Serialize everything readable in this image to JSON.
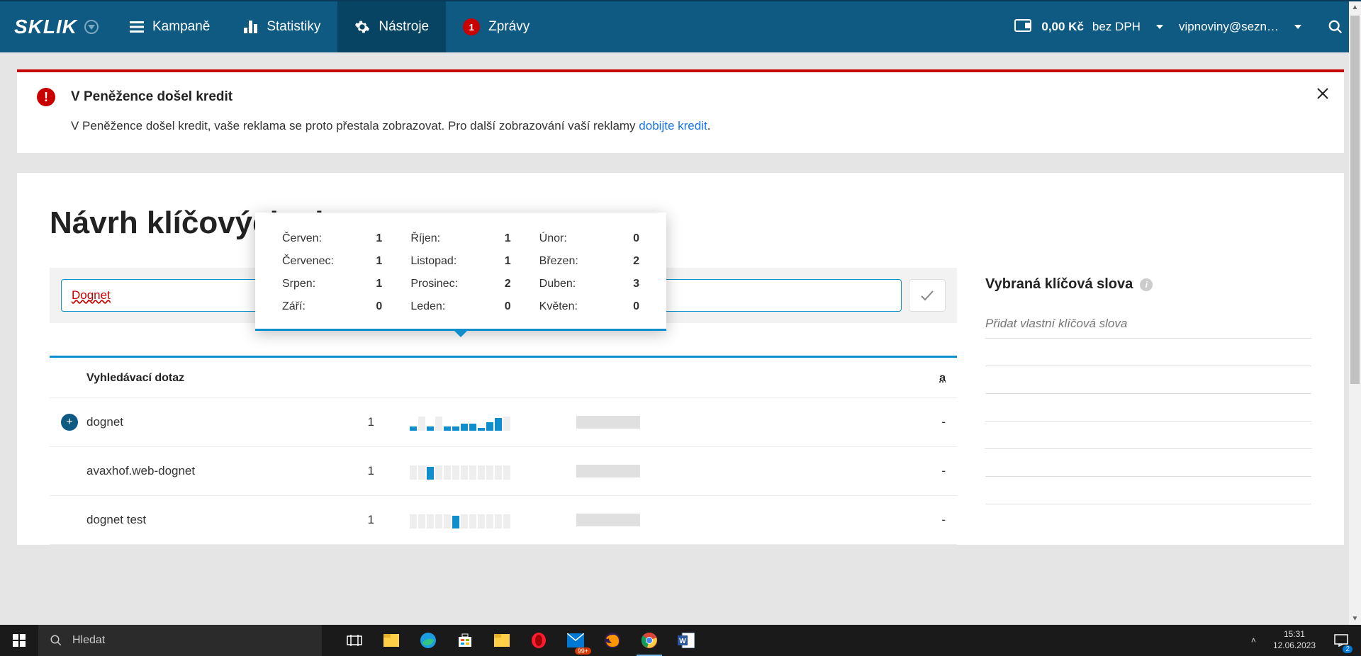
{
  "header": {
    "logo": "SKLIK",
    "nav": {
      "campaigns": "Kampaně",
      "stats": "Statistiky",
      "tools": "Nástroje",
      "messages": "Zprávy",
      "messages_badge": "1"
    },
    "balance": "0,00 Kč",
    "vat": "bez DPH",
    "user": "vipnoviny@sezn…"
  },
  "alert": {
    "title": "V Peněžence došel kredit",
    "body_prefix": "V Peněžence došel kredit, vaše reklama se proto přestala zobrazovat. Pro další zobrazování vaší reklamy ",
    "link": "dobijte kredit",
    "body_suffix": "."
  },
  "page": {
    "title": "Návrh klíčových slov",
    "search_value": "Dognet",
    "table": {
      "col_kw": "Vyhledávací dotaz",
      "col_comp_suffix": "a"
    },
    "rows": [
      {
        "kw": "dognet",
        "searches": "1",
        "trend": [
          6,
          0,
          6,
          0,
          6,
          6,
          10,
          10,
          4,
          12,
          18,
          0
        ],
        "comp": "-",
        "add": true
      },
      {
        "kw": "avaxhof.web-dognet",
        "searches": "1",
        "trend": [
          0,
          0,
          18,
          0,
          0,
          0,
          0,
          0,
          0,
          0,
          0,
          0
        ],
        "comp": "-",
        "add": false
      },
      {
        "kw": "dognet test",
        "searches": "1",
        "trend": [
          0,
          0,
          0,
          0,
          0,
          18,
          0,
          0,
          0,
          0,
          0,
          0
        ],
        "comp": "-",
        "add": false
      }
    ]
  },
  "tooltip": {
    "col1": [
      {
        "label": "Červen:",
        "val": "1"
      },
      {
        "label": "Červenec:",
        "val": "1"
      },
      {
        "label": "Srpen:",
        "val": "1"
      },
      {
        "label": "Září:",
        "val": "0"
      }
    ],
    "col2": [
      {
        "label": "Říjen:",
        "val": "1"
      },
      {
        "label": "Listopad:",
        "val": "1"
      },
      {
        "label": "Prosinec:",
        "val": "2"
      },
      {
        "label": "Leden:",
        "val": "0"
      }
    ],
    "col3": [
      {
        "label": "Únor:",
        "val": "0"
      },
      {
        "label": "Březen:",
        "val": "2"
      },
      {
        "label": "Duben:",
        "val": "3"
      },
      {
        "label": "Květen:",
        "val": "0"
      }
    ]
  },
  "selected": {
    "title": "Vybraná klíčová slova",
    "placeholder": "Přidat vlastní klíčová slova"
  },
  "taskbar": {
    "search": "Hledat",
    "time": "15:31",
    "date": "12.06.2023",
    "notif": "2",
    "badge99": "99+"
  },
  "chart_data": {
    "type": "bar",
    "note": "monthly search volume sparkline for 'dognet'",
    "categories": [
      "Červen",
      "Červenec",
      "Srpen",
      "Září",
      "Říjen",
      "Listopad",
      "Prosinec",
      "Leden",
      "Únor",
      "Březen",
      "Duben",
      "Květen"
    ],
    "values": [
      1,
      1,
      1,
      0,
      1,
      1,
      2,
      0,
      0,
      2,
      3,
      0
    ],
    "ylim": [
      0,
      3
    ]
  }
}
